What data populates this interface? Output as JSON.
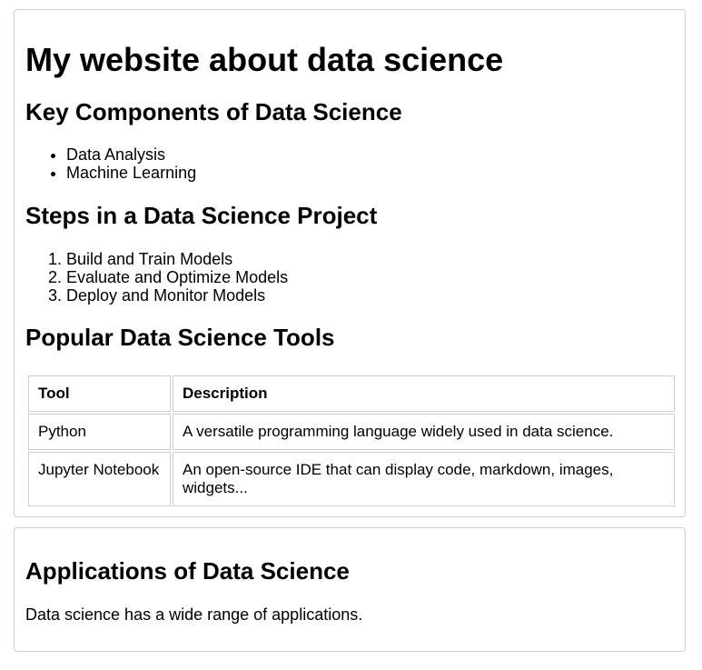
{
  "main": {
    "title": "My website about data science",
    "key_components": {
      "heading": "Key Components of Data Science",
      "items": [
        "Data Analysis",
        "Machine Learning"
      ]
    },
    "steps": {
      "heading": "Steps in a Data Science Project",
      "items": [
        "Build and Train Models",
        "Evaluate and Optimize Models",
        "Deploy and Monitor Models"
      ]
    },
    "tools": {
      "heading": "Popular Data Science Tools",
      "columns": [
        "Tool",
        "Description"
      ],
      "rows": [
        [
          "Python",
          "A versatile programming language widely used in data science."
        ],
        [
          "Jupyter Notebook",
          "An open-source IDE that can display code, markdown, images, widgets..."
        ]
      ]
    }
  },
  "applications": {
    "heading": "Applications of Data Science",
    "text": "Data science has a wide range of applications."
  },
  "colors": {
    "border": "#cfcfcf",
    "text": "#000000",
    "background": "#ffffff"
  }
}
